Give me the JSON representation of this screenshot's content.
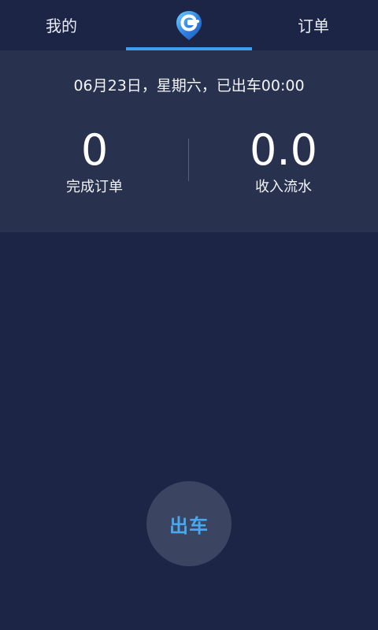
{
  "topbar": {
    "left_tab": "我的",
    "right_tab": "订单",
    "logo_icon": "g-location-logo-icon",
    "accent_color": "#3ea0ea"
  },
  "summary": {
    "date_line": "06月23日，星期六，已出车00:00",
    "stats": [
      {
        "value": "0",
        "label": "完成订单"
      },
      {
        "value": "0.0",
        "label": "收入流水"
      }
    ]
  },
  "action": {
    "start_label": "出车",
    "start_color": "#48a9f1"
  }
}
